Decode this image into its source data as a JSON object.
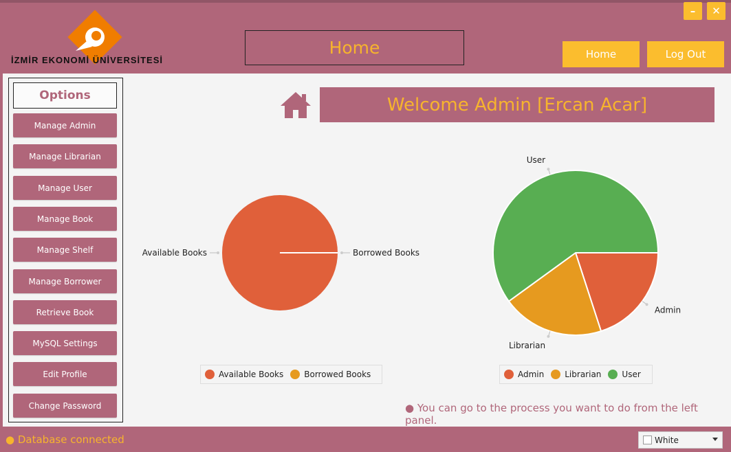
{
  "logo": {
    "text": "İZMİR EKONOMİ ÜNİVERSİTESİ"
  },
  "header": {
    "title": "Home",
    "home_label": "Home",
    "logout_label": "Log Out",
    "minimize": "–",
    "close": "✕"
  },
  "sidebar": {
    "title": "Options",
    "items": [
      {
        "label": "Manage Admin"
      },
      {
        "label": "Manage Librarian"
      },
      {
        "label": "Manage User"
      },
      {
        "label": "Manage Book"
      },
      {
        "label": "Manage Shelf"
      },
      {
        "label": "Manage Borrower"
      },
      {
        "label": "Retrieve Book"
      },
      {
        "label": "MySQL Settings"
      },
      {
        "label": "Edit Profile"
      },
      {
        "label": "Change Password"
      }
    ]
  },
  "welcome": "Welcome Admin [Ercan Acar]",
  "chart_data": [
    {
      "type": "pie",
      "categories": [
        "Available Books",
        "Borrowed Books"
      ],
      "values": [
        100,
        0
      ],
      "colors": [
        "#e0603a",
        "#e69a1f"
      ],
      "legend": [
        "Available Books",
        "Borrowed Books"
      ]
    },
    {
      "type": "pie",
      "categories": [
        "Admin",
        "Librarian",
        "User"
      ],
      "values": [
        20,
        20,
        60
      ],
      "colors": [
        "#e0603a",
        "#e69a1f",
        "#58ae52"
      ],
      "legend": [
        "Admin",
        "Librarian",
        "User"
      ]
    }
  ],
  "hint": "● You can go to the process you want to do from the left panel.",
  "footer": {
    "db_status": "● Database connected",
    "theme": "White"
  },
  "colors": {
    "primary": "#b0667a",
    "accent": "#fbbd2e"
  }
}
